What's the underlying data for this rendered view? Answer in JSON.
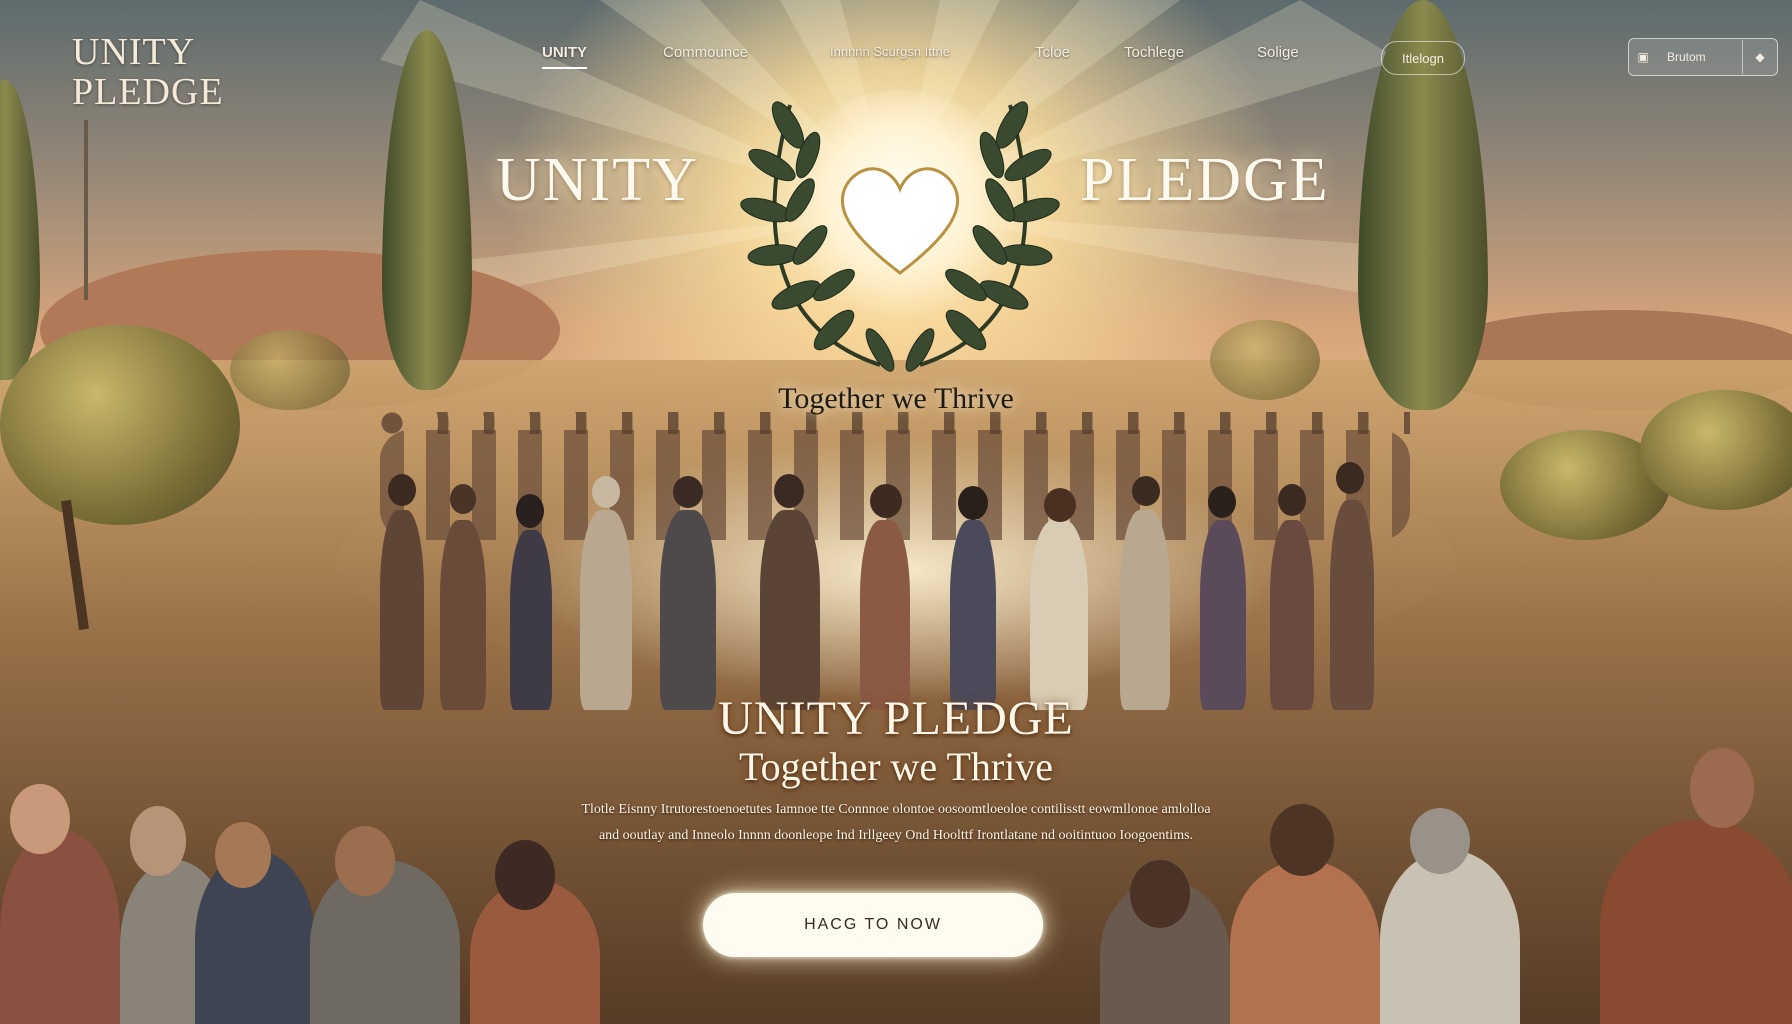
{
  "brand": {
    "logo_line1": "UNITY",
    "logo_line2": "PLEDGE"
  },
  "nav": {
    "items": [
      {
        "label": "UNITY",
        "active": true
      },
      {
        "label": "Commounce"
      },
      {
        "label": "Innnnn Scurgsn Ittne"
      },
      {
        "label": "Tcloe"
      },
      {
        "label": "Tochlege"
      },
      {
        "label": "Solige"
      }
    ],
    "pill_label": "Itlelogn",
    "search": {
      "text": "Brutom",
      "icon": "search-icon",
      "button_icon": "diamond-icon"
    }
  },
  "hero": {
    "word_left": "UNITY",
    "word_right": "PLEDGE",
    "emblem": "laurel-wreath-heart",
    "tagline": "Together we Thrive"
  },
  "main": {
    "title": "UNITY PLEDGE",
    "subtitle": "Together we Thrive",
    "body_line1": "Tlotle Eisnny Itrutorestoenoetutes Iamnoe tte Connnoe olontoe oosoomtloeoloe contilisstt eowmllonoe amlolloa",
    "body_line2": "and ooutlay and Inneolo Innnn doonleope Ind Irllgeey Ond Hoolttf Irontlatane nd ooitintuoo Ioogoentims.",
    "cta_label": "HACG TO NOW"
  },
  "colors": {
    "accent": "#fffbf0",
    "sky_top": "#5d6b6e",
    "glow": "#ffe6b4",
    "ground": "#5a3f2a"
  }
}
